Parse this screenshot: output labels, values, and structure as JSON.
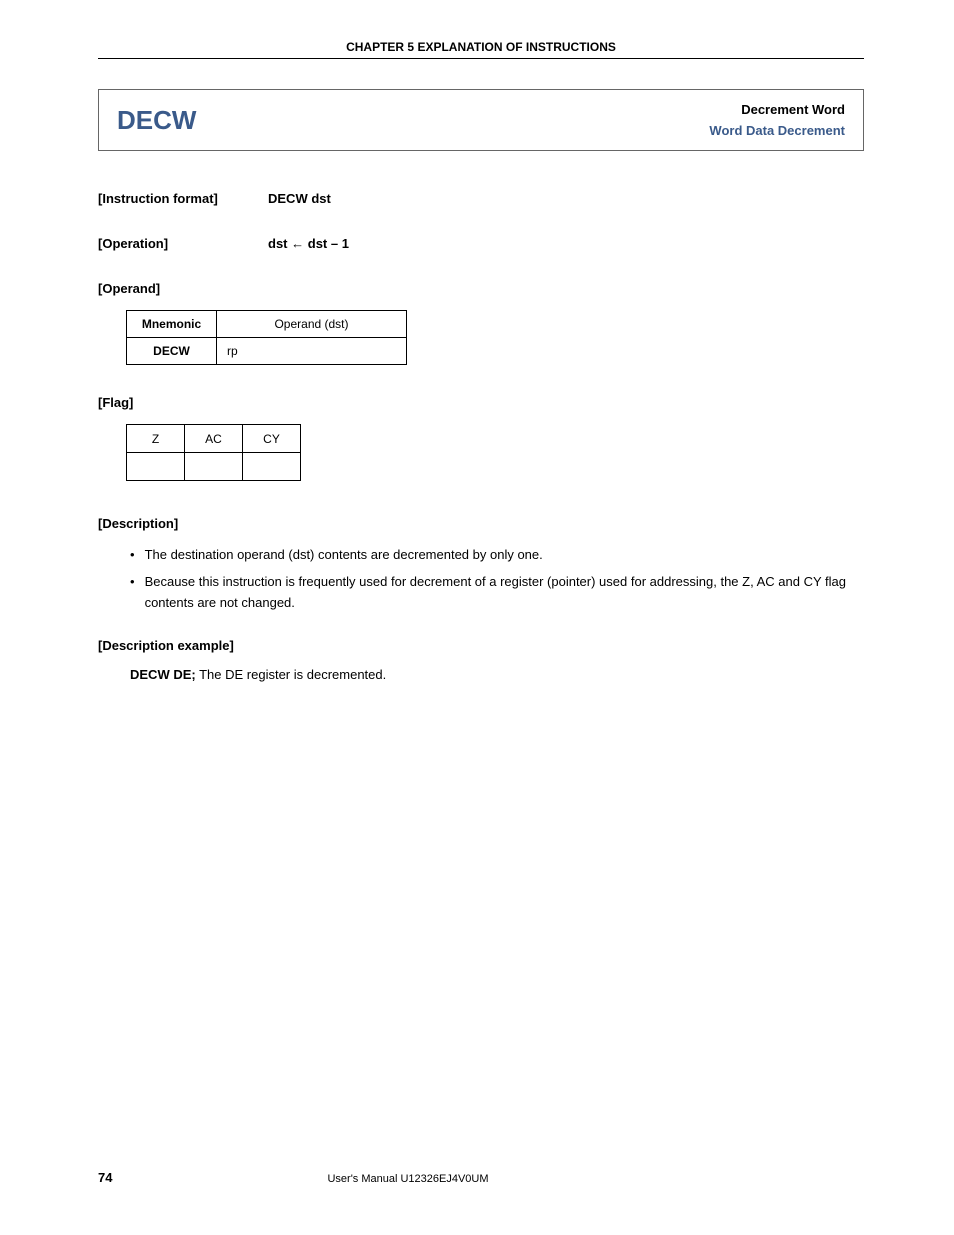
{
  "chapter": {
    "header": "CHAPTER 5   EXPLANATION OF INSTRUCTIONS"
  },
  "instruction": {
    "mnemonic": "DECW",
    "title_main": "Decrement Word",
    "title_sub": "Word Data Decrement"
  },
  "format": {
    "label": "[Instruction format]",
    "value": "DECW dst"
  },
  "operation": {
    "label": "[Operation]",
    "expression_lhs": "dst",
    "expression_arrow": "←",
    "expression_rhs": "dst – 1"
  },
  "operand": {
    "label": "[Operand]",
    "table": {
      "header_col1": "Mnemonic",
      "header_col2": "Operand (dst)",
      "row_mnemonic": "DECW",
      "row_operand": "rp"
    }
  },
  "flag": {
    "label": "[Flag]",
    "headers": [
      "Z",
      "AC",
      "CY"
    ],
    "values": [
      "",
      "",
      ""
    ]
  },
  "description": {
    "label": "[Description]",
    "items": [
      "The destination operand (dst) contents are decremented by only one.",
      "Because this instruction is frequently used for decrement of a register (pointer) used for addressing, the Z, AC and CY flag contents are not changed."
    ]
  },
  "example": {
    "label": "[Description example]",
    "code": "DECW DE;",
    "text": "  The DE register is decremented."
  },
  "footer": {
    "page": "74",
    "manual": "User's Manual  U12326EJ4V0UM"
  }
}
